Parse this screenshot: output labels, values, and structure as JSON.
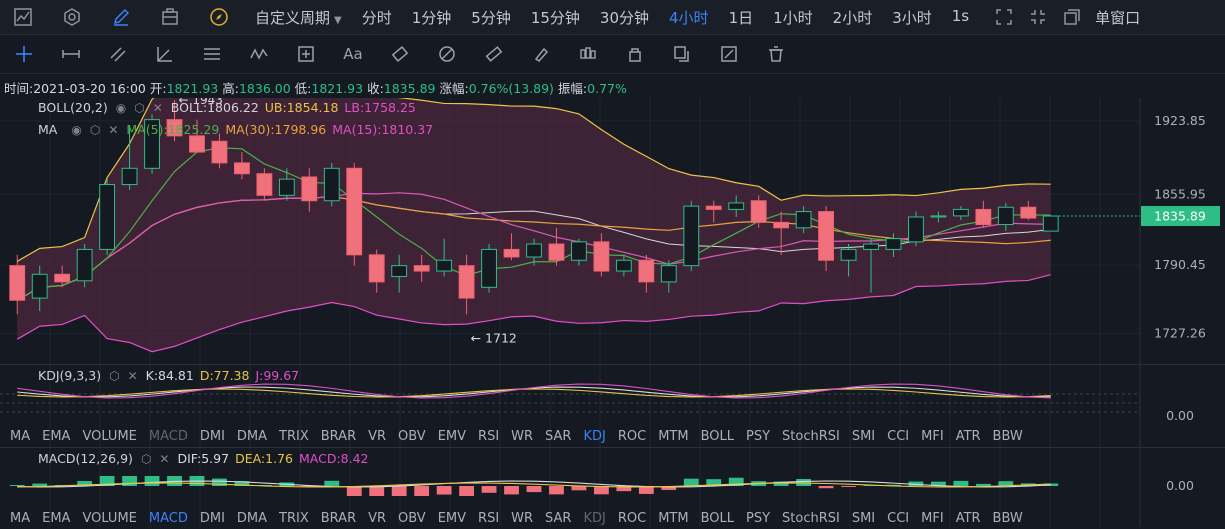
{
  "topbar": {
    "period_dropdown": "自定义周期",
    "periods": [
      "分时",
      "1分钟",
      "5分钟",
      "15分钟",
      "30分钟",
      "4小时",
      "1日",
      "1小时",
      "2小时",
      "3小时",
      "1s"
    ],
    "active_period": "4小时",
    "window_mode": "单窗口"
  },
  "info": {
    "time_label": "时间:",
    "time": "2021-03-20 16:00",
    "open_label": "开:",
    "open": "1821.93",
    "high_label": "高:",
    "high": "1836.00",
    "low_label": "低:",
    "low": "1821.93",
    "close_label": "收:",
    "close": "1835.89",
    "change_label": "涨幅:",
    "change": "0.76%(13.89)",
    "amp_label": "振幅:",
    "amp": "0.77%"
  },
  "boll_legend": {
    "name": "BOLL(20,2)",
    "boll": "BOLL:1806.22",
    "ub": "UB:1854.18",
    "lb": "LB:1758.25"
  },
  "ma_legend": {
    "name": "MA",
    "ma5": "MA(5):1825.29",
    "ma30": "MA(30):1798.96",
    "ma15": "MA(15):1810.37"
  },
  "price_axis": [
    "1923.85",
    "1855.95",
    "1790.45",
    "1727.26"
  ],
  "current_price": "1835.89",
  "annotations": {
    "high": "← 1943",
    "low": "← 1712"
  },
  "kdj_legend": {
    "name": "KDJ(9,3,3)",
    "k": "K:84.81",
    "d": "D:77.38",
    "j": "J:99.67"
  },
  "kdj_axis": "0.00",
  "macd_legend": {
    "name": "MACD(12,26,9)",
    "dif": "DIF:5.97",
    "dea": "DEA:1.76",
    "macd": "MACD:8.42"
  },
  "macd_axis": "0.00",
  "indicator_tabs": [
    "MA",
    "EMA",
    "VOLUME",
    "MACD",
    "DMI",
    "DMA",
    "TRIX",
    "BRAR",
    "VR",
    "OBV",
    "EMV",
    "RSI",
    "WR",
    "SAR",
    "KDJ",
    "ROC",
    "MTM",
    "BOLL",
    "PSY",
    "StochRSI",
    "SMI",
    "CCI",
    "MFI",
    "ATR",
    "BBW"
  ],
  "colors": {
    "up": "#2ebd85",
    "down": "#f0616d",
    "ub_line": "#e8c547",
    "lb_line": "#e04fc6",
    "accent": "#3b82f6"
  },
  "chart_data": {
    "type": "candlestick",
    "price_range": [
      1700,
      1945
    ],
    "candles": [
      {
        "o": 1790,
        "h": 1800,
        "l": 1745,
        "c": 1758
      },
      {
        "o": 1760,
        "h": 1790,
        "l": 1748,
        "c": 1782
      },
      {
        "o": 1782,
        "h": 1790,
        "l": 1770,
        "c": 1775
      },
      {
        "o": 1776,
        "h": 1810,
        "l": 1770,
        "c": 1805
      },
      {
        "o": 1805,
        "h": 1870,
        "l": 1800,
        "c": 1865
      },
      {
        "o": 1865,
        "h": 1920,
        "l": 1860,
        "c": 1880
      },
      {
        "o": 1880,
        "h": 1930,
        "l": 1875,
        "c": 1925
      },
      {
        "o": 1925,
        "h": 1943,
        "l": 1905,
        "c": 1910
      },
      {
        "o": 1910,
        "h": 1925,
        "l": 1895,
        "c": 1895
      },
      {
        "o": 1905,
        "h": 1912,
        "l": 1880,
        "c": 1885
      },
      {
        "o": 1885,
        "h": 1895,
        "l": 1870,
        "c": 1875
      },
      {
        "o": 1875,
        "h": 1880,
        "l": 1850,
        "c": 1855
      },
      {
        "o": 1855,
        "h": 1880,
        "l": 1850,
        "c": 1870
      },
      {
        "o": 1872,
        "h": 1880,
        "l": 1840,
        "c": 1850
      },
      {
        "o": 1850,
        "h": 1885,
        "l": 1845,
        "c": 1880
      },
      {
        "o": 1880,
        "h": 1885,
        "l": 1790,
        "c": 1800
      },
      {
        "o": 1800,
        "h": 1805,
        "l": 1765,
        "c": 1775
      },
      {
        "o": 1780,
        "h": 1800,
        "l": 1765,
        "c": 1790
      },
      {
        "o": 1790,
        "h": 1800,
        "l": 1775,
        "c": 1785
      },
      {
        "o": 1785,
        "h": 1815,
        "l": 1780,
        "c": 1795
      },
      {
        "o": 1790,
        "h": 1800,
        "l": 1745,
        "c": 1760
      },
      {
        "o": 1770,
        "h": 1810,
        "l": 1765,
        "c": 1805
      },
      {
        "o": 1805,
        "h": 1820,
        "l": 1795,
        "c": 1798
      },
      {
        "o": 1798,
        "h": 1815,
        "l": 1790,
        "c": 1810
      },
      {
        "o": 1810,
        "h": 1825,
        "l": 1790,
        "c": 1795
      },
      {
        "o": 1795,
        "h": 1815,
        "l": 1790,
        "c": 1812
      },
      {
        "o": 1812,
        "h": 1820,
        "l": 1780,
        "c": 1785
      },
      {
        "o": 1785,
        "h": 1800,
        "l": 1780,
        "c": 1795
      },
      {
        "o": 1795,
        "h": 1800,
        "l": 1765,
        "c": 1775
      },
      {
        "o": 1775,
        "h": 1795,
        "l": 1765,
        "c": 1790
      },
      {
        "o": 1790,
        "h": 1850,
        "l": 1785,
        "c": 1845
      },
      {
        "o": 1845,
        "h": 1850,
        "l": 1830,
        "c": 1842
      },
      {
        "o": 1842,
        "h": 1855,
        "l": 1835,
        "c": 1848
      },
      {
        "o": 1850,
        "h": 1855,
        "l": 1825,
        "c": 1830
      },
      {
        "o": 1830,
        "h": 1840,
        "l": 1800,
        "c": 1825
      },
      {
        "o": 1825,
        "h": 1845,
        "l": 1820,
        "c": 1840
      },
      {
        "o": 1840,
        "h": 1845,
        "l": 1785,
        "c": 1795
      },
      {
        "o": 1795,
        "h": 1810,
        "l": 1780,
        "c": 1805
      },
      {
        "o": 1805,
        "h": 1815,
        "l": 1765,
        "c": 1810
      },
      {
        "o": 1805,
        "h": 1820,
        "l": 1798,
        "c": 1815
      },
      {
        "o": 1812,
        "h": 1840,
        "l": 1808,
        "c": 1835
      },
      {
        "o": 1835,
        "h": 1840,
        "l": 1830,
        "c": 1836
      },
      {
        "o": 1836,
        "h": 1845,
        "l": 1832,
        "c": 1842
      },
      {
        "o": 1842,
        "h": 1850,
        "l": 1825,
        "c": 1828
      },
      {
        "o": 1828,
        "h": 1848,
        "l": 1822,
        "c": 1844
      },
      {
        "o": 1844,
        "h": 1850,
        "l": 1832,
        "c": 1834
      },
      {
        "o": 1821.93,
        "h": 1836,
        "l": 1821.93,
        "c": 1835.89
      }
    ]
  }
}
